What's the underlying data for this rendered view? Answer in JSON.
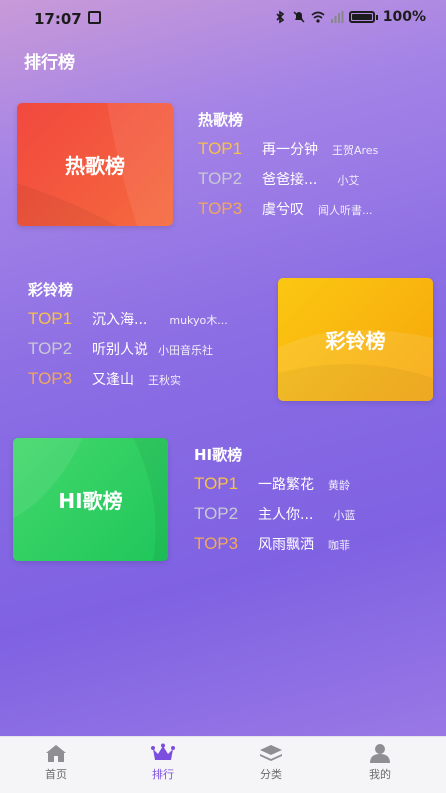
{
  "status_bar": {
    "time": "17:07",
    "battery": "100%"
  },
  "page_title": "排行榜",
  "rankings": [
    {
      "cover_label": "热歌榜",
      "title": "热歌榜",
      "color": "#f2483f",
      "items": [
        {
          "rank": "TOP1",
          "song": "再一分钟",
          "artist": "王贺Ares"
        },
        {
          "rank": "TOP2",
          "song": "爸爸接...",
          "artist": "小艾"
        },
        {
          "rank": "TOP3",
          "song": "虞兮叹",
          "artist": "闻人听書..."
        }
      ]
    },
    {
      "cover_label": "彩铃榜",
      "title": "彩铃榜",
      "color": "#fbc712",
      "items": [
        {
          "rank": "TOP1",
          "song": "沉入海...",
          "artist": "mukyo木..."
        },
        {
          "rank": "TOP2",
          "song": "听别人说",
          "artist": "小田音乐社"
        },
        {
          "rank": "TOP3",
          "song": "又逢山",
          "artist": "王秋实"
        }
      ]
    },
    {
      "cover_label": "HI歌榜",
      "title": "HI歌榜",
      "color": "#43d86c",
      "items": [
        {
          "rank": "TOP1",
          "song": "一路繁花",
          "artist": "黄龄"
        },
        {
          "rank": "TOP2",
          "song": "主人你...",
          "artist": "小蓝"
        },
        {
          "rank": "TOP3",
          "song": "风雨飘洒",
          "artist": "咖菲"
        }
      ]
    }
  ],
  "tab_bar": {
    "active": "排行",
    "items": [
      {
        "label": "首页",
        "icon": "home-icon"
      },
      {
        "label": "排行",
        "icon": "crown-icon"
      },
      {
        "label": "分类",
        "icon": "layers-icon"
      },
      {
        "label": "我的",
        "icon": "user-icon"
      }
    ]
  },
  "accent_color": "#7b4ee0"
}
